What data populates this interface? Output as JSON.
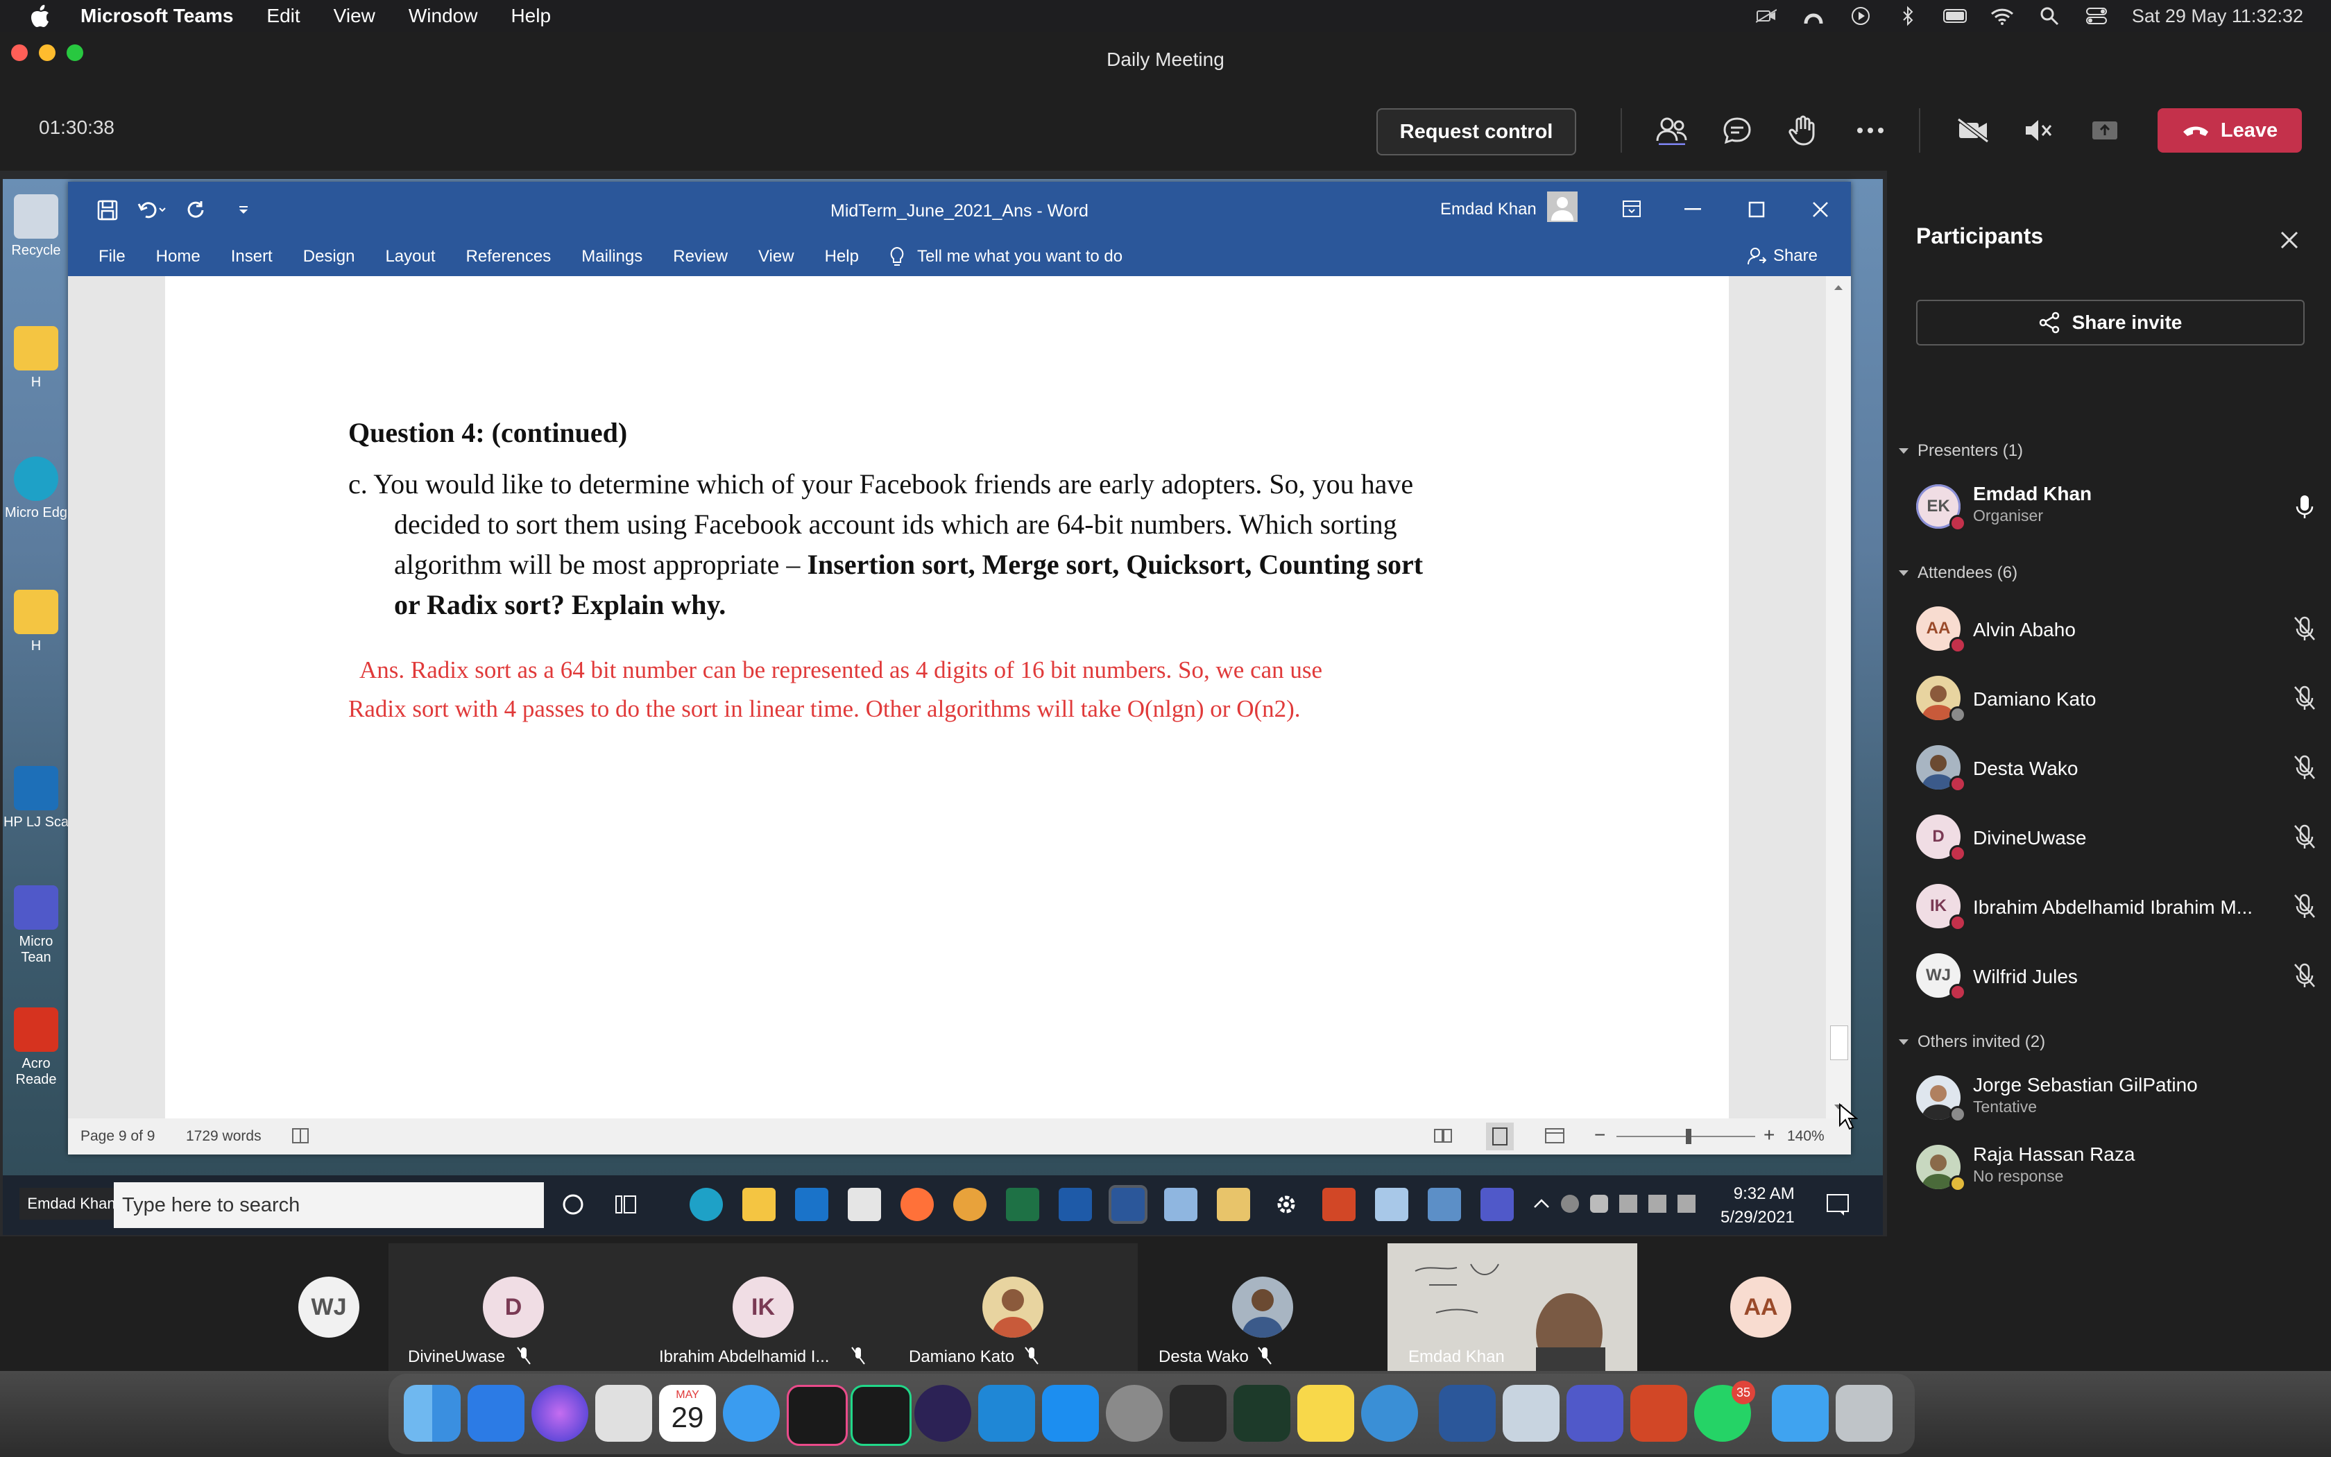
{
  "menubar": {
    "app_name": "Microsoft Teams",
    "items": [
      "Edit",
      "View",
      "Window",
      "Help"
    ],
    "datetime": "Sat 29 May  11:32:32"
  },
  "window": {
    "title": "Daily Meeting"
  },
  "meeting": {
    "timer": "01:30:38",
    "request_control": "Request control",
    "leave": "Leave",
    "accent": "#c4314b"
  },
  "shared_screen": {
    "desktop_icons": [
      {
        "label": "Recycle"
      },
      {
        "label": "H"
      },
      {
        "label": "Micro Edg"
      },
      {
        "label": "H"
      },
      {
        "label": "HP LJ Sca"
      },
      {
        "label": "Micro Tean"
      },
      {
        "label": "Acro Reade"
      }
    ],
    "word": {
      "doc_title": "MidTerm_June_2021_Ans  -  Word",
      "user": "Emdad Khan",
      "ribbon": [
        "File",
        "Home",
        "Insert",
        "Design",
        "Layout",
        "References",
        "Mailings",
        "Review",
        "View",
        "Help"
      ],
      "tell_me": "Tell me what you want to do",
      "share": "Share",
      "heading": "Question 4: (continued)",
      "question_lines": [
        "c.  You would like to determine which of your Facebook friends are early adopters. So, you have",
        "decided to sort them using Facebook account ids which are 64-bit numbers.  Which sorting",
        "algorithm will be most appropriate – ",
        "Insertion sort, Merge sort, Quicksort, Counting sort",
        "or Radix sort?  Explain why."
      ],
      "answer_lines": [
        "Ans.  Radix sort as a 64 bit number can be represented as 4 digits of 16 bit numbers. So, we can use",
        "Radix sort with 4 passes to do the sort in linear time. Other algorithms will take O(nlgn) or O(n2)."
      ],
      "status": {
        "page": "Page 9 of 9",
        "words": "1729 words",
        "zoom": "140%"
      }
    },
    "taskbar": {
      "presenter_label": "Emdad Khan",
      "search_placeholder": "Type here to search",
      "time": "9:32 AM",
      "date": "5/29/2021"
    }
  },
  "gallery": [
    {
      "initials": "WJ",
      "name": ""
    },
    {
      "initials": "D",
      "name": "DivineUwase"
    },
    {
      "initials": "IK",
      "name": "Ibrahim Abdelhamid I..."
    },
    {
      "initials": "",
      "name": "Damiano Kato"
    },
    {
      "initials": "",
      "name": "Desta Wako"
    },
    {
      "initials": "",
      "name": "Emdad Khan"
    },
    {
      "initials": "AA",
      "name": ""
    }
  ],
  "participants": {
    "title": "Participants",
    "share_invite": "Share invite",
    "presenters_header": "Presenters (1)",
    "attendees_header": "Attendees (6)",
    "others_header": "Others invited (2)",
    "presenters": [
      {
        "initials": "EK",
        "name": "Emdad Khan",
        "role": "Organiser"
      }
    ],
    "attendees": [
      {
        "initials": "AA",
        "name": "Alvin Abaho"
      },
      {
        "initials": "",
        "name": "Damiano Kato"
      },
      {
        "initials": "",
        "name": "Desta Wako"
      },
      {
        "initials": "D",
        "name": "DivineUwase"
      },
      {
        "initials": "IK",
        "name": "Ibrahim Abdelhamid Ibrahim M..."
      },
      {
        "initials": "WJ",
        "name": "Wilfrid Jules"
      }
    ],
    "others": [
      {
        "initials": "",
        "name": "Jorge Sebastian GilPatino",
        "status": "Tentative"
      },
      {
        "initials": "",
        "name": "Raja Hassan Raza",
        "status": "No response"
      }
    ]
  },
  "dock": {
    "calendar_month": "MAY",
    "calendar_day": "29",
    "whatsapp_badge": "35"
  }
}
